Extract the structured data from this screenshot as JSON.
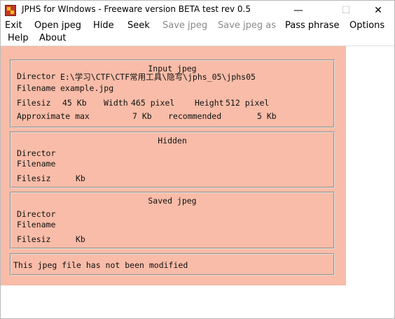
{
  "window": {
    "title": "JPHS for WIndows - Freeware version BETA test rev 0.5",
    "controls": {
      "minimize": "—",
      "maximize": "☐",
      "close": "✕"
    }
  },
  "menu": {
    "row1": [
      {
        "label": "Exit",
        "enabled": true
      },
      {
        "label": "Open jpeg",
        "enabled": true
      },
      {
        "label": "Hide",
        "enabled": true
      },
      {
        "label": "Seek",
        "enabled": true
      },
      {
        "label": "Save jpeg",
        "enabled": false
      },
      {
        "label": "Save jpeg as",
        "enabled": false
      },
      {
        "label": "Pass phrase",
        "enabled": true
      },
      {
        "label": "Options",
        "enabled": true
      }
    ],
    "row2": [
      {
        "label": "Help",
        "enabled": true
      },
      {
        "label": "About",
        "enabled": true
      }
    ]
  },
  "input_jpeg": {
    "title": "Input jpeg",
    "directory_label": "Director",
    "directory_value": "E:\\学习\\CTF\\CTF常用工具\\隐写\\jphs_05\\jphs05",
    "filename_label": "Filename",
    "filename_value": "example.jpg",
    "filesize_label": "Filesiz",
    "filesize_value": "45 Kb",
    "width_label": "Width",
    "width_value": "465 pixel",
    "height_label": "Height",
    "height_value": "512 pixel",
    "approx_label": "Approximate max",
    "approx_value": "7 Kb",
    "recommended_label": "recommended",
    "recommended_value": "5 Kb"
  },
  "hidden": {
    "title": "Hidden",
    "directory_label": "Director",
    "filename_label": "Filename",
    "filesize_label": "Filesiz",
    "filesize_unit": "Kb"
  },
  "saved_jpeg": {
    "title": "Saved jpeg",
    "directory_label": "Director",
    "filename_label": "Filename",
    "filesize_label": "Filesiz",
    "filesize_unit": "Kb"
  },
  "status": {
    "message": "This jpeg file has not been modified"
  },
  "colors": {
    "client_bg": "#f8bca8",
    "window_bg": "#ffffff"
  }
}
